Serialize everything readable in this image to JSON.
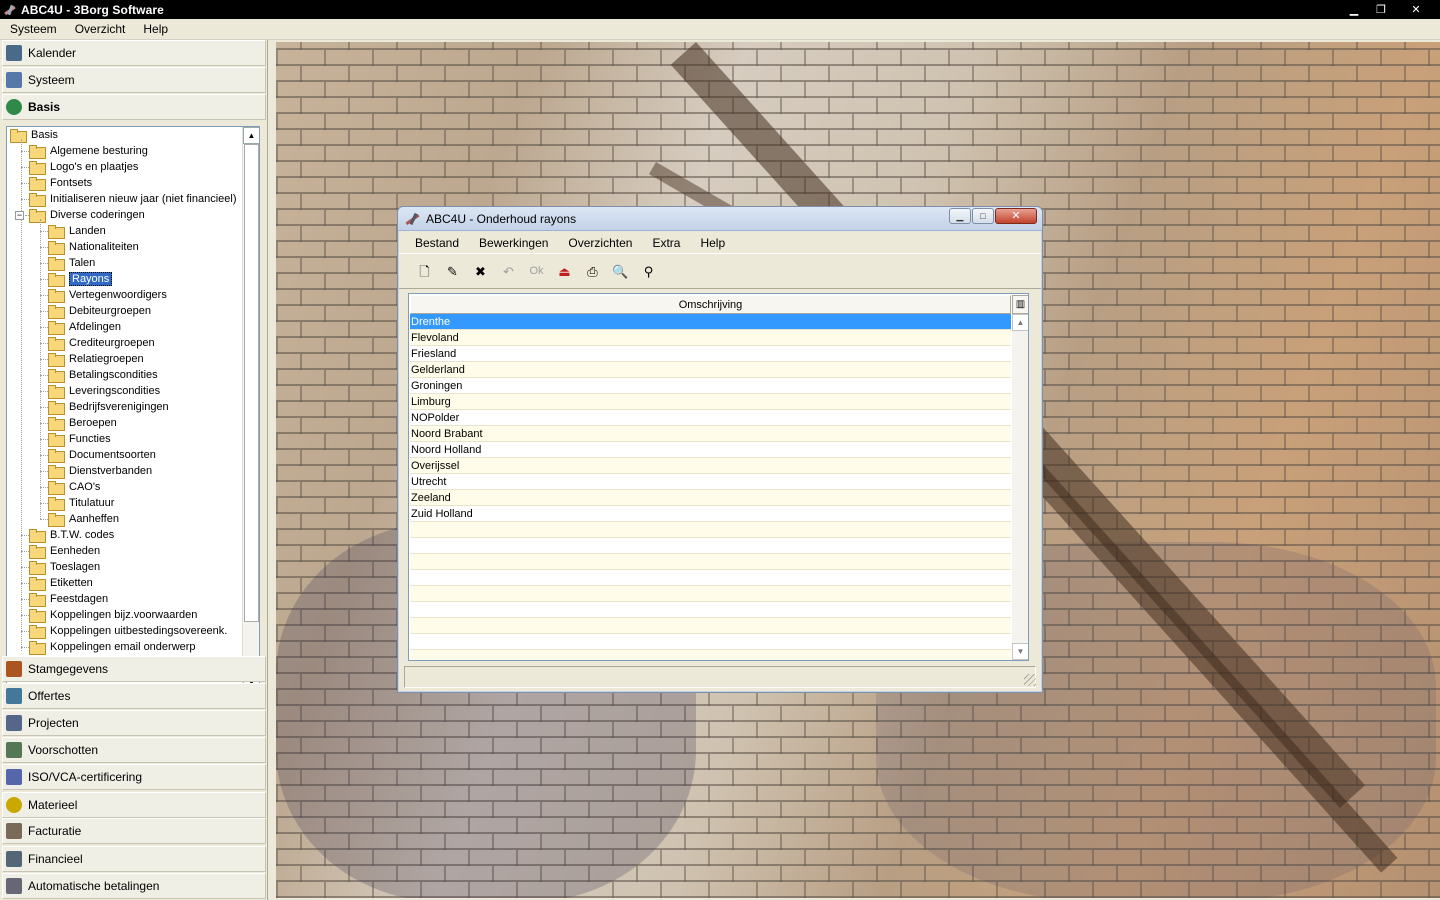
{
  "app": {
    "title": "ABC4U - 3Borg Software"
  },
  "menubar": {
    "items": [
      "Systeem",
      "Overzicht",
      "Help"
    ]
  },
  "nav": {
    "top": [
      {
        "label": "Kalender",
        "icon": "calendar-icon"
      },
      {
        "label": "Systeem",
        "icon": "monitor-icon"
      },
      {
        "label": "Basis",
        "icon": "globe-icon"
      }
    ],
    "bottom": [
      {
        "label": "Stamgegevens",
        "icon": "person-icon"
      },
      {
        "label": "Offertes",
        "icon": "document-grid-icon"
      },
      {
        "label": "Projecten",
        "icon": "project-icon"
      },
      {
        "label": "Voorschotten",
        "icon": "money-icon"
      },
      {
        "label": "ISO/VCA-certificering",
        "icon": "certificate-icon"
      },
      {
        "label": "Materieel",
        "icon": "gear-icon"
      },
      {
        "label": "Facturatie",
        "icon": "pencil-icon"
      },
      {
        "label": "Financieel",
        "icon": "ledger-icon"
      },
      {
        "label": "Automatische betalingen",
        "icon": "bank-icon"
      }
    ]
  },
  "tree": {
    "root": "Basis",
    "level1a": [
      "Algemene besturing",
      "Logo's en plaatjes",
      "Fontsets",
      "Initialiseren nieuw jaar (niet financieel)"
    ],
    "group": "Diverse coderingen",
    "children": [
      "Landen",
      "Nationaliteiten",
      "Talen",
      "Rayons",
      "Vertegenwoordigers",
      "Debiteurgroepen",
      "Afdelingen",
      "Crediteurgroepen",
      "Relatiegroepen",
      "Betalingscondities",
      "Leveringscondities",
      "Bedrijfsverenigingen",
      "Beroepen",
      "Functies",
      "Documentsoorten",
      "Dienstverbanden",
      "CAO's",
      "Titulatuur",
      "Aanheffen"
    ],
    "selected": "Rayons",
    "level1b": [
      "B.T.W. codes",
      "Eenheden",
      "Toeslagen",
      "Etiketten",
      "Feestdagen",
      "Koppelingen bijz.voorwaarden",
      "Koppelingen uitbestedingsovereenk.",
      "Koppelingen email onderwerp"
    ]
  },
  "dialog": {
    "title": "ABC4U - Onderhoud rayons",
    "menu": [
      "Bestand",
      "Bewerkingen",
      "Overzichten",
      "Extra",
      "Help"
    ],
    "toolbar": [
      {
        "name": "new-icon",
        "glyph": "🗋",
        "enabled": true
      },
      {
        "name": "edit-icon",
        "glyph": "✎",
        "enabled": true
      },
      {
        "name": "delete-icon",
        "glyph": "✖",
        "enabled": true
      },
      {
        "name": "undo-icon",
        "glyph": "↶",
        "enabled": false
      },
      {
        "name": "ok-icon",
        "glyph": "Ok",
        "enabled": false
      },
      {
        "name": "exit-icon",
        "glyph": "⏏",
        "enabled": true
      },
      {
        "name": "print-icon",
        "glyph": "⎙",
        "enabled": true
      },
      {
        "name": "preview-icon",
        "glyph": "🔍",
        "enabled": true
      },
      {
        "name": "find-icon",
        "glyph": "⚲",
        "enabled": true
      }
    ],
    "grid": {
      "header": "Omschrijving",
      "rows": [
        "Drenthe",
        "Flevoland",
        "Friesland",
        "Gelderland",
        "Groningen",
        "Limburg",
        "NOPolder",
        "Noord Brabant",
        "Noord Holland",
        "Overijssel",
        "Utrecht",
        "Zeeland",
        "Zuid Holland"
      ],
      "selected_index": 0,
      "empty_rows": 9
    }
  },
  "colors": {
    "selection": "#3399ff",
    "tree_selection": "#316ac5",
    "row_alt": "#fffde9"
  }
}
